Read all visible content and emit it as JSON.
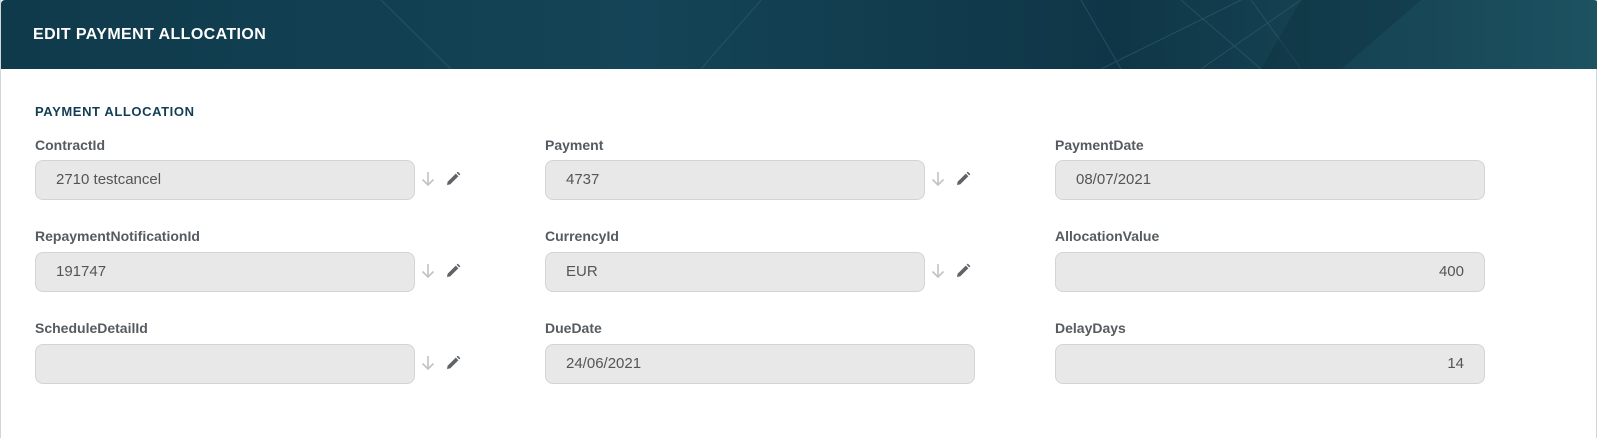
{
  "dialog": {
    "title": "EDIT PAYMENT ALLOCATION"
  },
  "section": {
    "title": "PAYMENT ALLOCATION"
  },
  "fields": {
    "contract_id": {
      "label": "ContractId",
      "value": "2710 testcancel"
    },
    "payment": {
      "label": "Payment",
      "value": "4737"
    },
    "payment_date": {
      "label": "PaymentDate",
      "value": "08/07/2021"
    },
    "repayment_notification_id": {
      "label": "RepaymentNotificationId",
      "value": "191747"
    },
    "currency_id": {
      "label": "CurrencyId",
      "value": "EUR"
    },
    "allocation_value": {
      "label": "AllocationValue",
      "value": "400"
    },
    "schedule_detail_id": {
      "label": "ScheduleDetailId",
      "value": ""
    },
    "due_date": {
      "label": "DueDate",
      "value": "24/06/2021"
    },
    "delay_days": {
      "label": "DelayDays",
      "value": "14"
    }
  },
  "icons": {
    "lookup": "arrow-down-icon",
    "edit": "pencil-icon"
  },
  "colors": {
    "header_bg": "#0f3a4b",
    "section_title": "#123d55",
    "field_bg": "#e8e8e8"
  }
}
